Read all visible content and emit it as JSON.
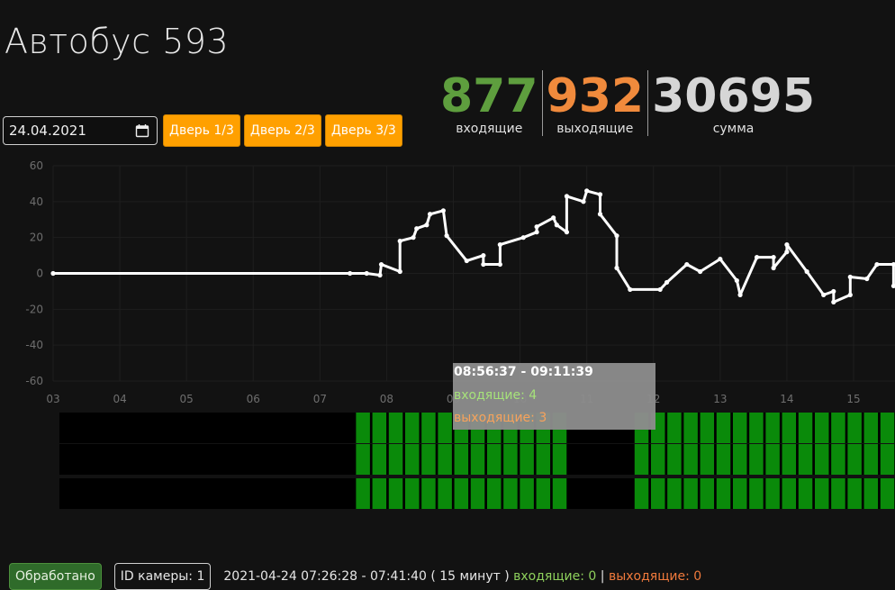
{
  "page": {
    "title": "Автобус 593"
  },
  "controls": {
    "date_value": "24.04.2021",
    "doors": [
      "Дверь 1/3",
      "Дверь 2/3",
      "Дверь 3/3"
    ]
  },
  "stats": {
    "incoming": {
      "value": "877",
      "label": "входящие"
    },
    "outgoing": {
      "value": "932",
      "label": "выходящие"
    },
    "total": {
      "value": "30695",
      "label": "сумма"
    }
  },
  "colors": {
    "accent": "#ffa000",
    "incoming": "#5e9e3e",
    "outgoing": "#f08a3c",
    "door_bar": "#0a8a0a"
  },
  "chart_data": {
    "type": "line",
    "title": "",
    "xlabel": "",
    "ylabel": "",
    "ylim": [
      -60,
      60
    ],
    "y_ticks": [
      60,
      40,
      20,
      0,
      -20,
      -40,
      -60
    ],
    "xlim": [
      3,
      16.2
    ],
    "x_tick_labels": [
      "03",
      "04",
      "05",
      "06",
      "07",
      "08",
      "09",
      "10",
      "11",
      "12",
      "13",
      "14",
      "15"
    ],
    "x_tick_values": [
      3,
      4,
      5,
      6,
      7,
      8,
      9,
      10,
      11,
      12,
      13,
      14,
      15
    ],
    "grid": true,
    "series": [
      {
        "name": "",
        "points": [
          [
            3.0,
            0
          ],
          [
            7.45,
            0
          ],
          [
            7.7,
            0
          ],
          [
            7.9,
            -1
          ],
          [
            7.92,
            5
          ],
          [
            8.2,
            1
          ],
          [
            8.2,
            18
          ],
          [
            8.4,
            20
          ],
          [
            8.45,
            25
          ],
          [
            8.6,
            27
          ],
          [
            8.65,
            33
          ],
          [
            8.85,
            35
          ],
          [
            8.9,
            21
          ],
          [
            9.2,
            7
          ],
          [
            9.45,
            10
          ],
          [
            9.45,
            5
          ],
          [
            9.7,
            5
          ],
          [
            9.7,
            16
          ],
          [
            10.05,
            20
          ],
          [
            10.25,
            23
          ],
          [
            10.25,
            26
          ],
          [
            10.5,
            31
          ],
          [
            10.55,
            27
          ],
          [
            10.7,
            23
          ],
          [
            10.7,
            43
          ],
          [
            10.95,
            40
          ],
          [
            11.0,
            46
          ],
          [
            11.2,
            44
          ],
          [
            11.2,
            33
          ],
          [
            11.45,
            21
          ],
          [
            11.45,
            3
          ],
          [
            11.65,
            -9
          ],
          [
            12.1,
            -9
          ],
          [
            12.2,
            -5
          ],
          [
            12.5,
            5
          ],
          [
            12.7,
            1
          ],
          [
            13.0,
            8
          ],
          [
            13.25,
            -4
          ],
          [
            13.3,
            -12
          ],
          [
            13.55,
            9
          ],
          [
            13.8,
            9
          ],
          [
            13.8,
            3
          ],
          [
            14.0,
            12
          ],
          [
            14.0,
            16
          ],
          [
            14.3,
            1
          ],
          [
            14.55,
            -12
          ],
          [
            14.7,
            -10
          ],
          [
            14.7,
            -16
          ],
          [
            14.95,
            -12
          ],
          [
            14.95,
            -2
          ],
          [
            15.2,
            -3
          ],
          [
            15.35,
            5
          ],
          [
            15.6,
            5
          ],
          [
            15.6,
            -7
          ],
          [
            15.85,
            -8
          ],
          [
            16.0,
            17
          ],
          [
            16.2,
            17
          ]
        ]
      }
    ]
  },
  "door_bars": {
    "rows": 3,
    "active_start": 7.5,
    "gap_start": 10.85,
    "gap_end": 11.45,
    "end": 16.2
  },
  "tooltip": {
    "title": "08:56:37 - 09:11:39",
    "incoming": "входящие: 4",
    "outgoing": "выходящие: 3"
  },
  "bottom": {
    "processed_label": "Обработано",
    "camera_label": "ID камеры: 1",
    "interval_text": "2021-04-24 07:26:28 - 07:41:40 ( 15 минут )",
    "incoming_text": "входящие: 0",
    "separator": "|",
    "outgoing_text": "выходящие: 0"
  }
}
